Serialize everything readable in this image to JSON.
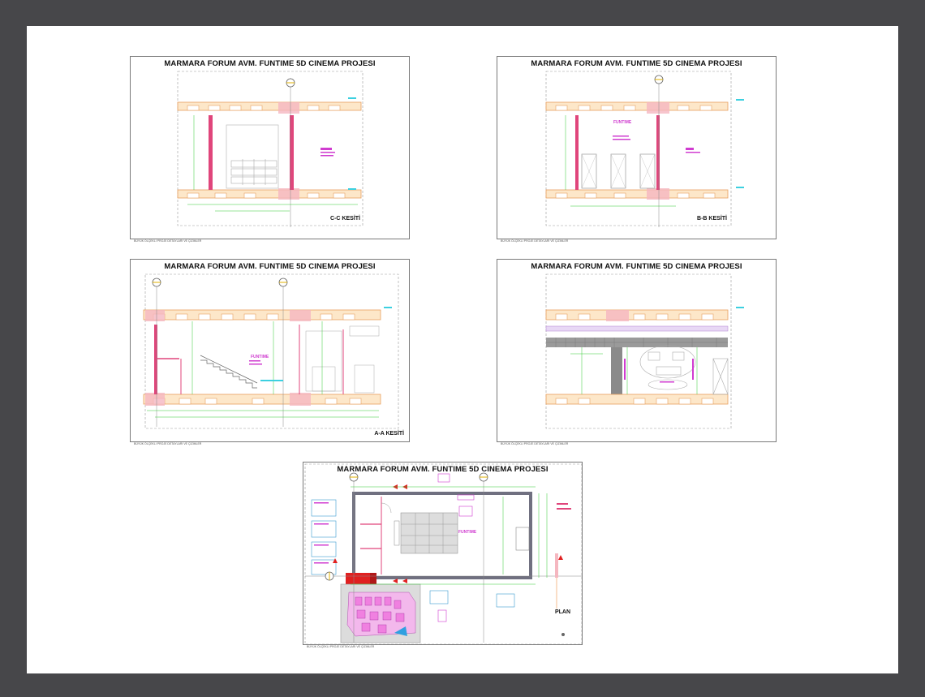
{
  "sheets": [
    {
      "id": "cc",
      "title": "MARMARA FORUM AVM. FUNTIME 5D CINEMA PROJESI",
      "label": "C-C KESİTİ",
      "footnote": "BÜYÜK ÖLÇEKLİ PROJE DETAYLARI VE ÇİZİMLER"
    },
    {
      "id": "bb",
      "title": "MARMARA FORUM AVM. FUNTIME 5D CINEMA PROJESI",
      "label": "B-B KESİTİ",
      "brand": "FUNTIME",
      "footnote": "BÜYÜK ÖLÇEKLİ PROJE DETAYLARI VE ÇİZİMLER"
    },
    {
      "id": "aa",
      "title": "MARMARA FORUM AVM. FUNTIME 5D CINEMA PROJESI",
      "label": "A-A KESİTİ",
      "brand": "FUNTIME",
      "footnote": "BÜYÜK ÖLÇEKLİ PROJE DETAYLARI VE ÇİZİMLER"
    },
    {
      "id": "el",
      "title": "MARMARA FORUM AVM. FUNTIME 5D CINEMA PROJESI",
      "label": "",
      "footnote": "BÜYÜK ÖLÇEKLİ PROJE DETAYLARI VE ÇİZİMLER"
    },
    {
      "id": "plan",
      "title": "MARMARA FORUM AVM. FUNTIME 5D CINEMA PROJESI",
      "label": "PLAN",
      "brand": "FUNTIME",
      "footnote": "BÜYÜK ÖLÇEKLİ PROJE DETAYLARI VE ÇİZİMLER"
    }
  ]
}
